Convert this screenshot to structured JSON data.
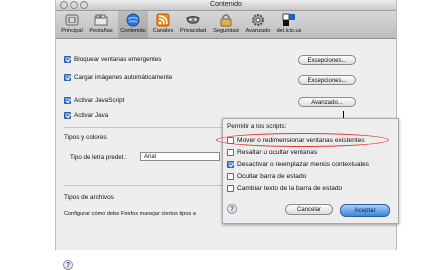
{
  "window": {
    "title": "Contenido"
  },
  "toolbar": {
    "tabs": [
      {
        "label": "Principal",
        "icon": "switch-icon"
      },
      {
        "label": "Pestañas",
        "icon": "tabs-icon"
      },
      {
        "label": "Contenido",
        "icon": "globe-icon",
        "selected": true
      },
      {
        "label": "Canales",
        "icon": "feed-icon"
      },
      {
        "label": "Privacidad",
        "icon": "mask-icon"
      },
      {
        "label": "Seguridad",
        "icon": "lock-icon"
      },
      {
        "label": "Avanzado",
        "icon": "gear-icon"
      },
      {
        "label": "del.icio.us",
        "icon": "delicious-icon"
      }
    ]
  },
  "content": {
    "block_popups": "Bloquear ventanas emergentes",
    "load_images": "Cargar imágenes automáticamente",
    "enable_javascript": "Activar JavaScript",
    "enable_java": "Activar Java",
    "exceptions_button_1": "Excepciones...",
    "exceptions_button_2": "Excepciones...",
    "advanced_button": "Avanzado...",
    "fonts_section": "Tipos y colores",
    "default_font_label": "Tipo de letra predet.:",
    "default_font_value": "Arial",
    "file_types_section": "Tipos de archivos",
    "file_types_text": "Configurar cómo debe Firefox manejar ciertos tipos a",
    "help": "?"
  },
  "sheet": {
    "header": "Permitir a los scripts:",
    "options": [
      {
        "label": "Mover o redimensionar ventanas existentes",
        "checked": false
      },
      {
        "label": "Resaltar u ocultar ventanas",
        "checked": false
      },
      {
        "label": "Desactivar o reemplazar menús contextuales",
        "checked": true
      },
      {
        "label": "Ocultar barra de estado",
        "checked": false
      },
      {
        "label": "Cambiar texto de la barra de estado",
        "checked": false
      }
    ],
    "cancel": "Cancelar",
    "accept": "Aceptar",
    "help": "?"
  },
  "colors": {
    "accent": "#3c84e0",
    "highlight": "#e63a2d"
  }
}
